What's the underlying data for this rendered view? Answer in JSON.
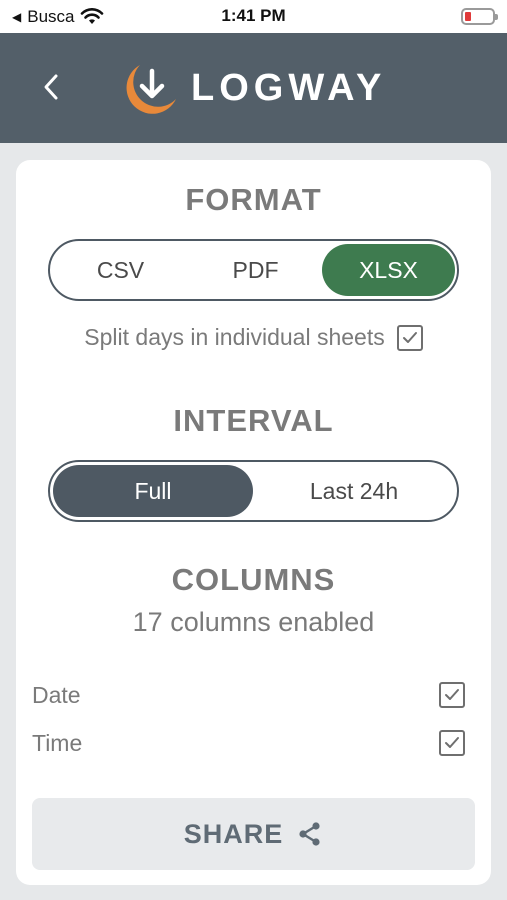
{
  "status_bar": {
    "back_app": "Busca",
    "time": "1:41 PM",
    "icons": [
      "back-triangle-icon",
      "wifi-icon",
      "battery-low-icon"
    ]
  },
  "header": {
    "logo_text": "LOGWAY",
    "icons": [
      "chevron-left-icon",
      "logway-logo-icon"
    ]
  },
  "format": {
    "title": "FORMAT",
    "options": [
      "CSV",
      "PDF",
      "XLSX"
    ],
    "selected": "XLSX",
    "split_label": "Split days in individual sheets",
    "split_checked": true
  },
  "interval": {
    "title": "INTERVAL",
    "options": [
      "Full",
      "Last 24h"
    ],
    "selected": "Full"
  },
  "columns": {
    "title": "COLUMNS",
    "summary": "17 columns enabled",
    "items": [
      {
        "label": "Date",
        "checked": true
      },
      {
        "label": "Time",
        "checked": true
      }
    ]
  },
  "share": {
    "label": "SHARE",
    "icon": "share-icon"
  },
  "colors": {
    "header_bg": "#535f69",
    "accent_green": "#3e7b4f",
    "accent_orange": "#e8893a",
    "segment_slate": "#4e5963",
    "page_bg": "#e6e8ea"
  }
}
